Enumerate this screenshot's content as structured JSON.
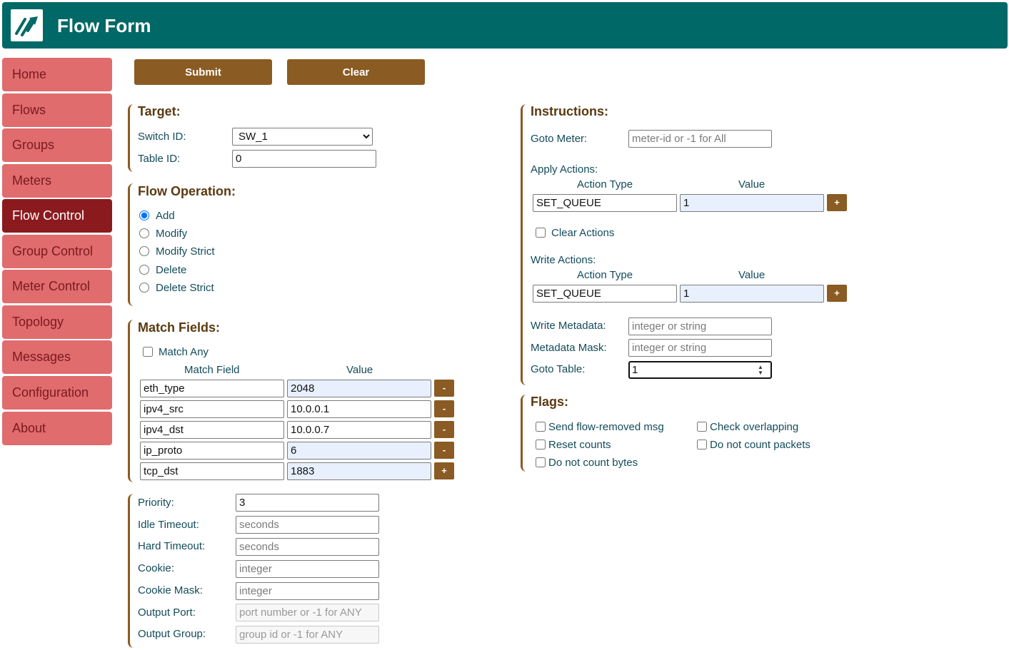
{
  "header": {
    "title": "Flow Form"
  },
  "sidebar": {
    "items": [
      {
        "label": "Home"
      },
      {
        "label": "Flows"
      },
      {
        "label": "Groups"
      },
      {
        "label": "Meters"
      },
      {
        "label": "Flow Control"
      },
      {
        "label": "Group Control"
      },
      {
        "label": "Meter Control"
      },
      {
        "label": "Topology"
      },
      {
        "label": "Messages"
      },
      {
        "label": "Configuration"
      },
      {
        "label": "About"
      }
    ],
    "active": "Flow Control"
  },
  "toolbar": {
    "submit_label": "Submit",
    "clear_label": "Clear"
  },
  "target": {
    "title": "Target:",
    "switch_label": "Switch ID:",
    "switch_value": "SW_1",
    "table_label": "Table ID:",
    "table_value": "0"
  },
  "operation": {
    "title": "Flow Operation:",
    "options": [
      "Add",
      "Modify",
      "Modify Strict",
      "Delete",
      "Delete Strict"
    ],
    "selected": "Add"
  },
  "match": {
    "title": "Match Fields:",
    "match_any_label": "Match Any",
    "col_field": "Match Field",
    "col_value": "Value",
    "rows": [
      {
        "field": "eth_type",
        "value": "2048",
        "btn": "-"
      },
      {
        "field": "ipv4_src",
        "value": "10.0.0.1",
        "btn": "-"
      },
      {
        "field": "ipv4_dst",
        "value": "10.0.0.7",
        "btn": "-"
      },
      {
        "field": "ip_proto",
        "value": "6",
        "btn": "-"
      },
      {
        "field": "tcp_dst",
        "value": "1883",
        "btn": "+"
      }
    ]
  },
  "misc": {
    "priority_label": "Priority:",
    "priority_value": "3",
    "idle_label": "Idle Timeout:",
    "idle_placeholder": "seconds",
    "hard_label": "Hard Timeout:",
    "hard_placeholder": "seconds",
    "cookie_label": "Cookie:",
    "cookie_placeholder": "integer",
    "cookie_mask_label": "Cookie Mask:",
    "cookie_mask_placeholder": "integer",
    "out_port_label": "Output Port:",
    "out_port_placeholder": "port number or -1 for ANY",
    "out_group_label": "Output Group:",
    "out_group_placeholder": "group id or -1 for ANY"
  },
  "instructions": {
    "title": "Instructions:",
    "goto_meter_label": "Goto Meter:",
    "goto_meter_placeholder": "meter-id or -1 for All",
    "apply_label": "Apply Actions:",
    "col_type": "Action Type",
    "col_value": "Value",
    "apply_type": "SET_QUEUE",
    "apply_value": "1",
    "clear_actions_label": "Clear Actions",
    "write_label": "Write Actions:",
    "write_type": "SET_QUEUE",
    "write_value": "1",
    "add_btn": "+",
    "write_metadata_label": "Write Metadata:",
    "write_metadata_placeholder": "integer or string",
    "metadata_mask_label": "Metadata Mask:",
    "metadata_mask_placeholder": "integer or string",
    "goto_table_label": "Goto Table:",
    "goto_table_value": "1"
  },
  "flags": {
    "title": "Flags:",
    "items": [
      "Send flow-removed msg",
      "Check overlapping",
      "Reset counts",
      "Do not count packets",
      "Do not count bytes"
    ]
  },
  "colors": {
    "header": "#006866",
    "nav": "#e06c6e",
    "nav_active": "#8b1a1e",
    "button": "#8a5b22"
  }
}
